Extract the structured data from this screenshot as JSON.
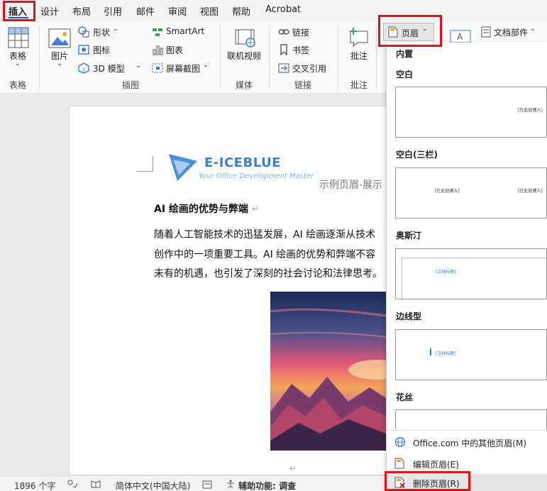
{
  "menu": {
    "tabs": [
      "插入",
      "设计",
      "布局",
      "引用",
      "邮件",
      "审阅",
      "视图",
      "帮助",
      "Acrobat"
    ]
  },
  "ribbon": {
    "table_label": "表格",
    "picture_label": "图片",
    "shapes_label": "形状",
    "icons_label": "图标",
    "model3d_label": "3D 模型",
    "smartart_label": "SmartArt",
    "chart_label": "图表",
    "screenshot_label": "屏幕截图",
    "online_video_label": "联机视频",
    "link_label": "链接",
    "bookmark_label": "书签",
    "crossref_label": "交叉引用",
    "comment_label": "批注",
    "header_label": "页眉",
    "docparts_label": "文档部件",
    "groups": {
      "tables": "表格",
      "illustrations": "插图",
      "media": "媒体",
      "links": "链接",
      "comments": "批注"
    }
  },
  "document": {
    "logo_brand": "E-ICEBLUE",
    "logo_tagline": "Your Office Development Master",
    "header_text": "示例页眉-展示",
    "title": "AI 绘画的优势与弊端",
    "paragraph_lines": [
      "随着人工智能技术的迅猛发展，AI 绘画逐渐从技术",
      "创作中的一项重要工具。AI 绘画的优势和弊端不容",
      "未有的机遇，也引发了深刻的社会讨论和法律思考。"
    ],
    "para_mark": "↵"
  },
  "gallery": {
    "section_builtin": "内置",
    "styles": [
      {
        "name": "空白",
        "placeholders": [
          "[在此处键入]"
        ]
      },
      {
        "name": "空白(三栏)",
        "placeholders": [
          "[在此处键入]",
          "[在此处键入]"
        ]
      },
      {
        "name": "奥斯汀",
        "placeholders": [
          "[文档标题]"
        ]
      },
      {
        "name": "边线型",
        "placeholders": [
          "[文档标题]"
        ]
      },
      {
        "name": "花丝",
        "placeholders": []
      }
    ],
    "menu_items": [
      "Office.com 中的其他页眉(M)",
      "编辑页眉(E)",
      "删除页眉(R)"
    ]
  },
  "status": {
    "word_count": "1896 个字",
    "language": "简体中文(中国大陆)",
    "accessibility": "辅助功能: 调查"
  },
  "colors": {
    "highlight": "#e0131b",
    "accent": "#185abd"
  }
}
